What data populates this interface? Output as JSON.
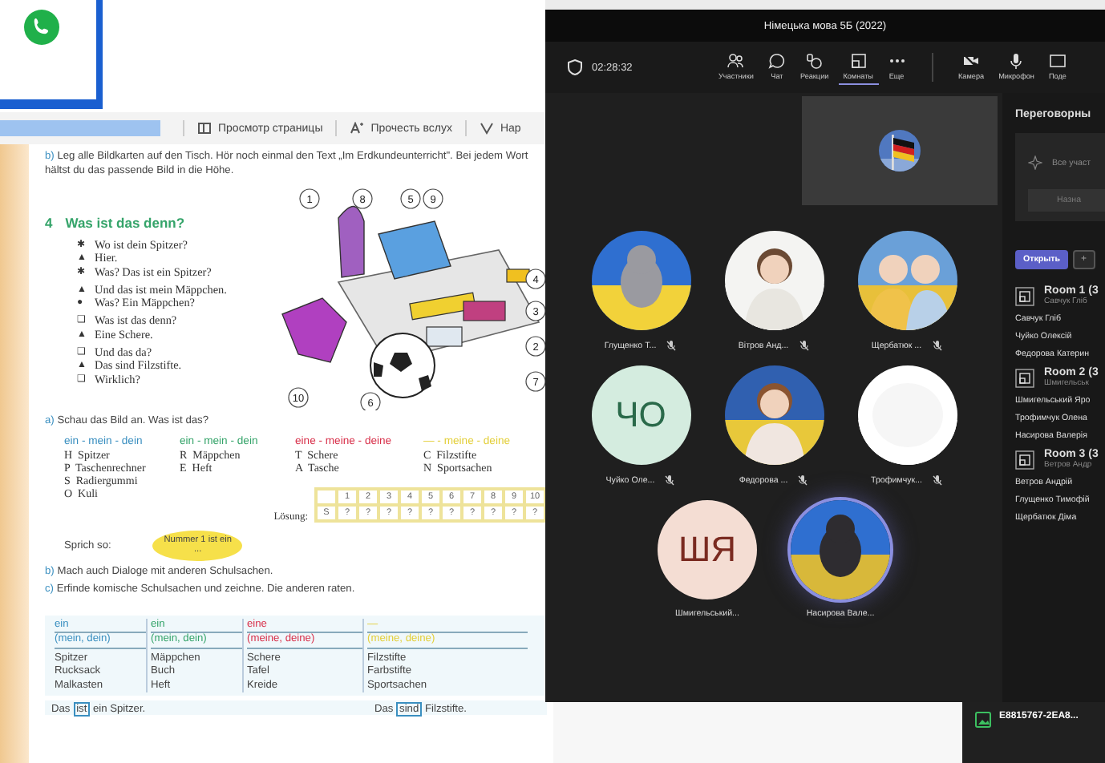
{
  "reader_toolbar": {
    "buttons": [
      {
        "label": "Просмотр страницы"
      },
      {
        "label": "Прочесть вслух"
      },
      {
        "label": "Нар"
      }
    ]
  },
  "textbook": {
    "task_b": {
      "marker": "b)",
      "text": "Leg alle Bildkarten auf den Tisch. Hör noch einmal den Text „Im Erdkundeunterricht\". Bei jedem Wort hältst du das passende Bild in die Höhe."
    },
    "exercise": {
      "number": "4",
      "title": "Was ist das denn?"
    },
    "dialogue": [
      [
        {
          "bullet": "✱",
          "text": "Wo ist dein Spitzer?"
        },
        {
          "bullet": "▲",
          "text": "Hier."
        },
        {
          "bullet": "✱",
          "text": "Was? Das ist ein Spitzer?"
        }
      ],
      [
        {
          "bullet": "▲",
          "text": "Und das ist mein Mäppchen."
        },
        {
          "bullet": "●",
          "text": "Was? Ein Mäppchen?"
        }
      ],
      [
        {
          "bullet": "❑",
          "text": "Was ist das denn?"
        },
        {
          "bullet": "▲",
          "text": "Eine Schere."
        }
      ],
      [
        {
          "bullet": "❑",
          "text": "Und das da?"
        },
        {
          "bullet": "▲",
          "text": "Das sind Filzstifte."
        },
        {
          "bullet": "❑",
          "text": "Wirklich?"
        }
      ]
    ],
    "callouts": [
      "1",
      "8",
      "5",
      "9",
      "4",
      "3",
      "2",
      "7",
      "6",
      "10"
    ],
    "task_a": {
      "marker": "a)",
      "text": "Schau das Bild an. Was ist das?"
    },
    "word_columns": [
      {
        "heading": "ein - mein - dein",
        "color": "#3a8fc0",
        "items": [
          "H  Spitzer",
          "P  Taschenrechner",
          "S  Radiergummi",
          "O  Kuli"
        ]
      },
      {
        "heading": "ein - mein - dein",
        "color": "#35a46a",
        "items": [
          "R  Mäppchen",
          "E  Heft"
        ]
      },
      {
        "heading": "eine - meine - deine",
        "color": "#d8304a",
        "items": [
          "T  Schere",
          "A  Tasche"
        ]
      },
      {
        "heading": "— - meine - deine",
        "color": "#e3cf3a",
        "items": [
          "C  Filzstifte",
          "N  Sportsachen"
        ]
      }
    ],
    "solution": {
      "label": "Lösung:",
      "numbers": [
        "1",
        "2",
        "3",
        "4",
        "5",
        "6",
        "7",
        "8",
        "9",
        "10"
      ],
      "answers": [
        "S",
        "?",
        "?",
        "?",
        "?",
        "?",
        "?",
        "?",
        "?",
        "?",
        "?"
      ]
    },
    "speak": {
      "label": "Sprich so:",
      "bubble": "Nummer 1 ist ein ..."
    },
    "task_b2": {
      "marker": "b)",
      "text": "Mach auch Dialoge mit anderen Schulsachen."
    },
    "task_c": {
      "marker": "c)",
      "text": "Erfinde komische Schulsachen und zeichne. Die anderen raten."
    },
    "grammar_table": [
      {
        "article": "ein",
        "possessive": "(mein, dein)",
        "color": "#3a8fc0",
        "nouns": [
          "Spitzer",
          "Rucksack",
          "Malkasten"
        ]
      },
      {
        "article": "ein",
        "possessive": "(mein, dein)",
        "color": "#35a46a",
        "nouns": [
          "Mäppchen",
          "Buch",
          "Heft"
        ]
      },
      {
        "article": "eine",
        "possessive": "(meine, deine)",
        "color": "#d8304a",
        "nouns": [
          "Schere",
          "Tafel",
          "Kreide"
        ]
      },
      {
        "article": "—",
        "possessive": "(meine, deine)",
        "color": "#e3cf3a",
        "nouns": [
          "Filzstifte",
          "Farbstifte",
          "Sportsachen"
        ]
      }
    ],
    "examples": [
      {
        "before": "Das",
        "boxed": "ist",
        "after": "ein Spitzer."
      },
      {
        "before": "Das",
        "boxed": "sind",
        "after": "Filzstifte."
      }
    ]
  },
  "teams": {
    "title": "Німецька мова 5Б (2022)",
    "timer": "02:28:32",
    "toolbar": [
      {
        "label": "Участники",
        "selected": false
      },
      {
        "label": "Чат",
        "selected": false
      },
      {
        "label": "Реакции",
        "selected": false
      },
      {
        "label": "Комнаты",
        "selected": true
      },
      {
        "label": "Еще",
        "selected": false
      }
    ],
    "device_buttons": [
      {
        "label": "Камера"
      },
      {
        "label": "Микрофон"
      },
      {
        "label": "Поде"
      }
    ],
    "participants": [
      {
        "name": "Глущенко Т...",
        "kind": "picture",
        "muted": true,
        "speaking": false
      },
      {
        "name": "Вітров Анд...",
        "kind": "picture",
        "muted": true,
        "speaking": false
      },
      {
        "name": "Щербатюк ...",
        "kind": "picture",
        "muted": true,
        "speaking": false
      },
      {
        "name": "Чуйко Оле...",
        "kind": "initials",
        "initials": "ЧО",
        "color": "#d4ecdf",
        "muted": true,
        "speaking": false
      },
      {
        "name": "Федорова ...",
        "kind": "picture",
        "muted": true,
        "speaking": false
      },
      {
        "name": "Трофимчук...",
        "kind": "picture",
        "muted": true,
        "speaking": false
      },
      {
        "name": "Шмигельський...",
        "kind": "initials",
        "initials": "ШЯ",
        "color": "#f4ddd3",
        "muted": false,
        "speaking": false
      },
      {
        "name": "Насирова Вале...",
        "kind": "picture",
        "muted": false,
        "speaking": true
      }
    ],
    "rooms_panel": {
      "title": "Переговорны",
      "notice": "Все участ",
      "assign_button": "Назна",
      "open_button": "Открыть",
      "add_button": "+",
      "rooms": [
        {
          "name": "Room 1 (3",
          "subtitle": "Савчук Гліб",
          "members": [
            "Савчук Гліб",
            "Чуйко Олексій",
            "Федорова Катерин"
          ]
        },
        {
          "name": "Room 2 (3",
          "subtitle": "Шмигельськ",
          "members": [
            "Шмигельський Яро",
            "Трофимчук Олена",
            "Насирова Валерія"
          ]
        },
        {
          "name": "Room 3 (3",
          "subtitle": "Ветров Андр",
          "members": [
            "Ветров Андрій",
            "Глущенко Тимофій",
            "Щербатюк Діма"
          ]
        }
      ]
    }
  },
  "taskbar_item": {
    "label": "E8815767-2EA8..."
  }
}
